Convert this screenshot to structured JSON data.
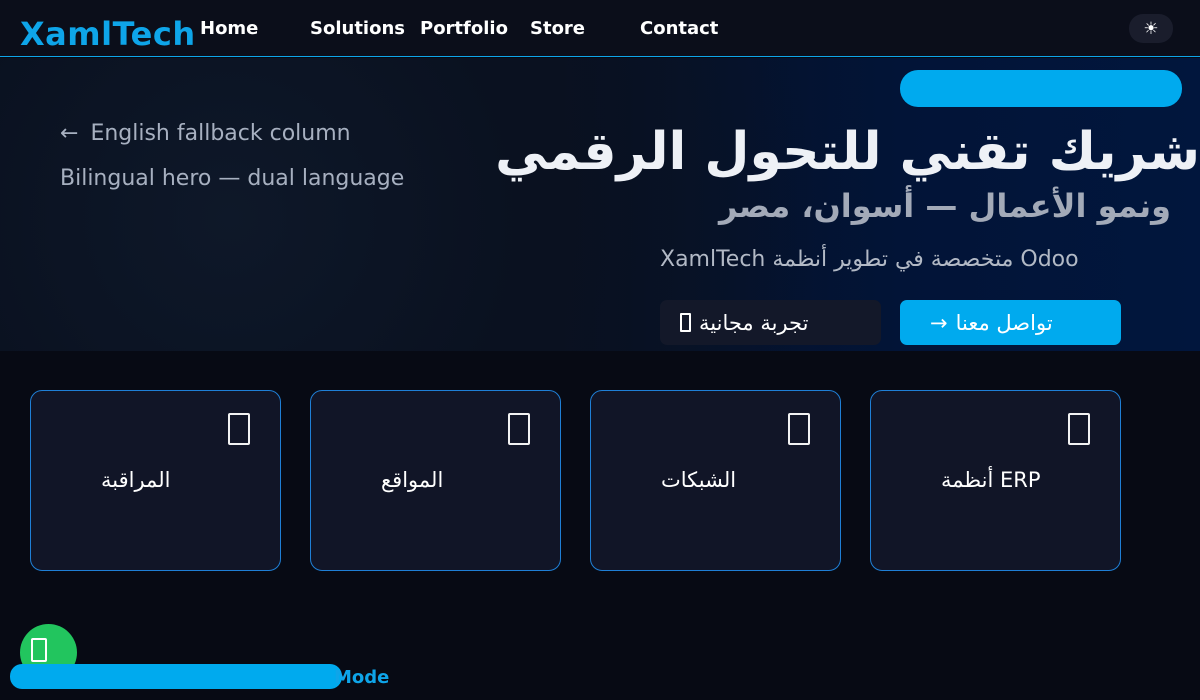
{
  "brand": {
    "name": "XamlTech"
  },
  "nav": {
    "items": [
      {
        "label": "Home"
      },
      {
        "label": "Solutions"
      },
      {
        "label": "Portfolio"
      },
      {
        "label": "Store"
      },
      {
        "label": "Contact"
      }
    ],
    "theme_toggle_icon": "☀"
  },
  "hero": {
    "fallback_title": "English fallback column",
    "fallback_arrow": "←",
    "fallback_subtitle": "Bilingual hero — dual language",
    "title": "شريك تقني للتحول الرقمي",
    "subtitle": "ونمو الأعمال — أسوان، مصر",
    "description": "XamlTech متخصصة في تطوير أنظمة Odoo",
    "trial_label": "تجربة مجانية",
    "contact_label": "تواصل معنا",
    "contact_arrow": "→"
  },
  "services": {
    "cards": [
      {
        "label": "المراقبة",
        "icon": "missing-glyph-icon"
      },
      {
        "label": "المواقع",
        "icon": "missing-glyph-icon"
      },
      {
        "label": "الشبكات",
        "icon": "missing-glyph-icon"
      },
      {
        "label": "أنظمة ERP",
        "icon": "missing-glyph-icon"
      }
    ]
  },
  "footer": {
    "whatsapp_icon": "whatsapp-icon",
    "mode_label": "Mode"
  },
  "colors": {
    "accent": "#0ea5e9",
    "button_primary": "#00aaee",
    "whatsapp": "#22c55e",
    "card_border": "#1f7fd6",
    "background": "#070a14"
  }
}
